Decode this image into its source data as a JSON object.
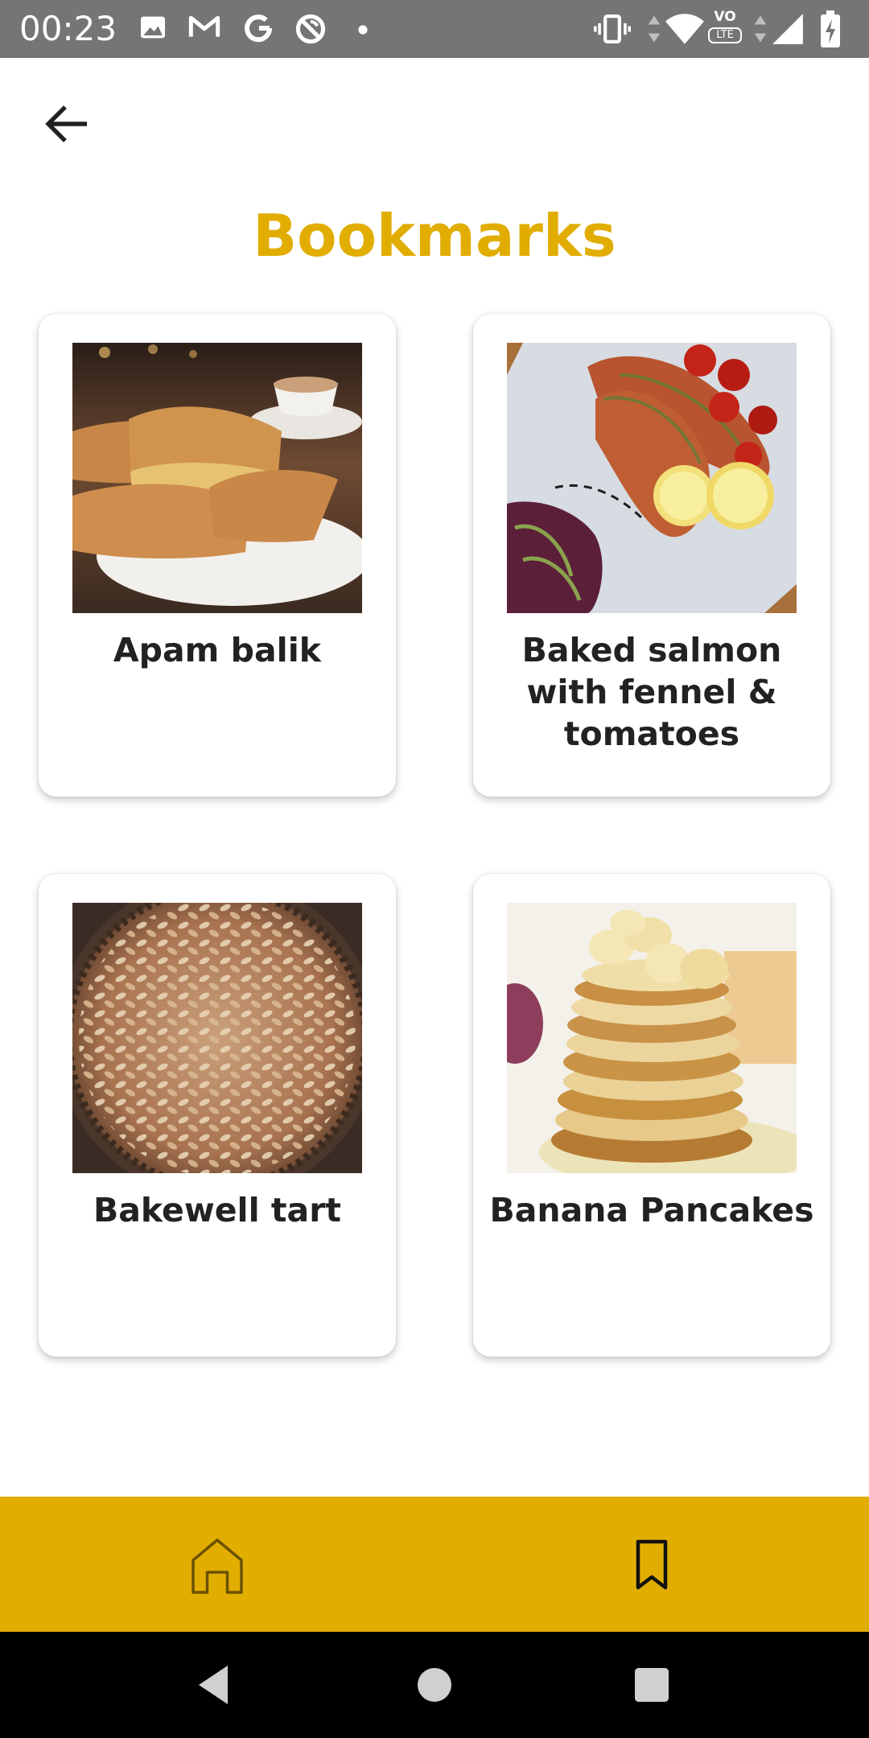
{
  "status_bar": {
    "time": "00:23",
    "left_icons": [
      "image-icon",
      "gmail-icon",
      "google-icon",
      "no-sync-icon",
      "dot-icon"
    ],
    "right_icons": [
      "vibrate-icon",
      "data-arrows-icon",
      "wifi-icon",
      "volte-icon",
      "signal-icon",
      "battery-charging-icon"
    ],
    "volte_label": "VO",
    "lte_label": "LTE"
  },
  "header": {
    "back_icon": "arrow-left-icon",
    "title": "Bookmarks"
  },
  "bookmarks": [
    {
      "title": "Apam balik"
    },
    {
      "title": "Baked salmon with fennel & tomatoes"
    },
    {
      "title": "Bakewell tart"
    },
    {
      "title": "Banana Pancakes"
    }
  ],
  "bottom_nav": {
    "items": [
      {
        "icon": "home-icon",
        "active": false
      },
      {
        "icon": "bookmark-icon",
        "active": true
      }
    ]
  },
  "system_nav": [
    "back-triangle-icon",
    "home-circle-icon",
    "recents-square-icon"
  ],
  "colors": {
    "accent": "#E1AD01",
    "status_bar": "#757575",
    "text": "#222222",
    "system_nav": "#000000"
  }
}
